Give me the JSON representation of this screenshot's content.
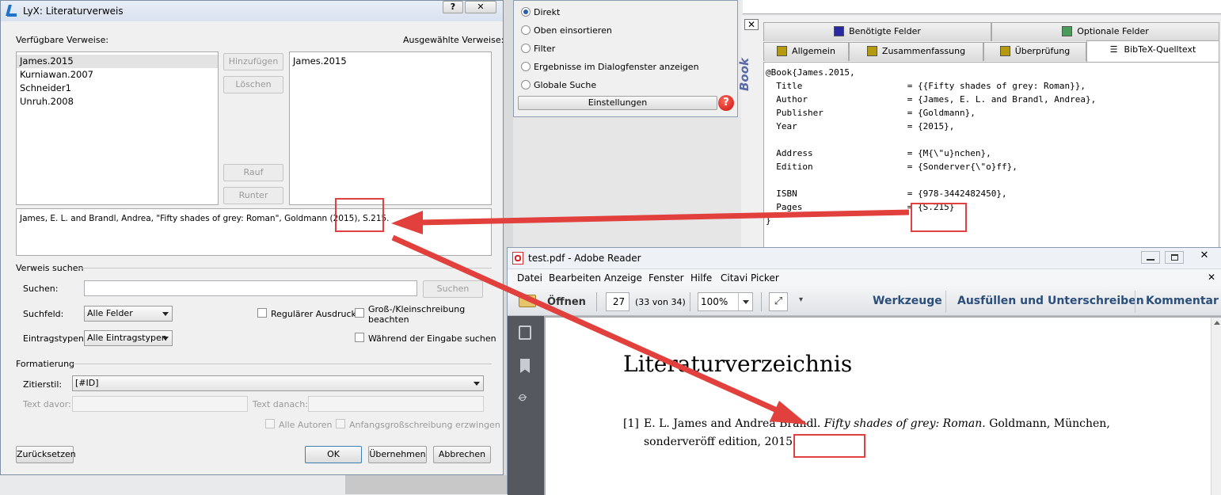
{
  "lyx": {
    "title": "LyX: Literaturverweis",
    "help_btn": "?",
    "available_label": "Verfügbare Verweise:",
    "selected_label": "Ausgewählte Verweise:",
    "available": [
      "James.2015",
      "Kurniawan.2007",
      "Schneider1",
      "Unruh.2008"
    ],
    "selected": [
      "James.2015"
    ],
    "btn_add": "Hinzufügen",
    "btn_delete": "Löschen",
    "btn_up": "Rauf",
    "btn_down": "Runter",
    "preview_text": "James, E. L. and Brandl, Andrea, \"Fifty shades of grey: Roman\", Goldmann (2015),",
    "preview_pages": "S.215.",
    "search_section": "Verweis suchen",
    "search_label": "Suchen:",
    "search_btn": "Suchen",
    "searchfield_label": "Suchfeld:",
    "searchfield_value": "Alle Felder",
    "regex_label": "Regulärer Ausdruck",
    "case_label_1": "Groß-/Kleinschreibung",
    "case_label_2": "beachten",
    "entrytypes_label": "Eintragstypen:",
    "entrytypes_value": "Alle Eintragstypen",
    "while_typing_label": "Während der Eingabe suchen",
    "format_section": "Formatierung",
    "citestyle_label": "Zitierstil:",
    "citestyle_value": "[#ID]",
    "text_before_label": "Text davor:",
    "text_after_label": "Text danach:",
    "all_authors_label": "Alle Autoren",
    "force_upper_label": "Anfangsgroßschreibung erzwingen",
    "btn_reset": "Zurücksetzen",
    "btn_ok": "OK",
    "btn_apply": "Übernehmen",
    "btn_cancel": "Abbrechen"
  },
  "search_panel": {
    "options": [
      "Direkt",
      "Oben einsortieren",
      "Filter",
      "Ergebnisse im Dialogfenster anzeigen",
      "Globale Suche"
    ],
    "selected_index": 0,
    "settings_btn": "Einstellungen"
  },
  "book_panel": {
    "side_label": "Book",
    "tabs_row1": [
      "Benötigte Felder",
      "Optionale Felder"
    ],
    "tabs_row1_colors": [
      "#2a2aa0",
      "#4a9a5a"
    ],
    "tabs_row2": [
      "Allgemein",
      "Zusammenfassung",
      "Überprüfung",
      "BibTeX-Quelltext"
    ],
    "tab_color": "#b49a10",
    "code_lines": [
      "@Book{James.2015,",
      "  Title                    = {{Fifty shades of grey: Roman}},",
      "  Author                   = {James, E. L. and Brandl, Andrea},",
      "  Publisher                = {Goldmann},",
      "  Year                     = {2015},",
      "",
      "  Address                  = {M{\\\"u}nchen},",
      "  Edition                  = {Sonderver{\\\"o}ff},",
      "",
      "  ISBN                     = {978-3442482450},",
      "  Pages                    = {S.215}",
      "}"
    ]
  },
  "reader": {
    "title": "test.pdf - Adobe Reader",
    "menu": [
      "Datei",
      "Bearbeiten",
      "Anzeige",
      "Fenster",
      "Hilfe",
      "Citavi Picker"
    ],
    "open_btn": "Öffnen",
    "page_num": "27",
    "page_of": "(33 von 34)",
    "zoom": "100%",
    "tools": "Werkzeuge",
    "fill_sign": "Ausfüllen und Unterschreiben",
    "comment": "Kommentar",
    "heading": "Literaturverzeichnis",
    "ref_num": "[1]",
    "ref_line1_a": "E. L. James and Andrea Brandl.",
    "ref_line1_title": "Fifty shades of grey: Roman.",
    "ref_line1_b": "Goldmann, München,",
    "ref_line2": "sonderveröff edition, 2015."
  },
  "colors": {
    "arrow": "#e2403c",
    "accent_blue": "#2b5797",
    "reader_link": "#2b4f7a"
  }
}
